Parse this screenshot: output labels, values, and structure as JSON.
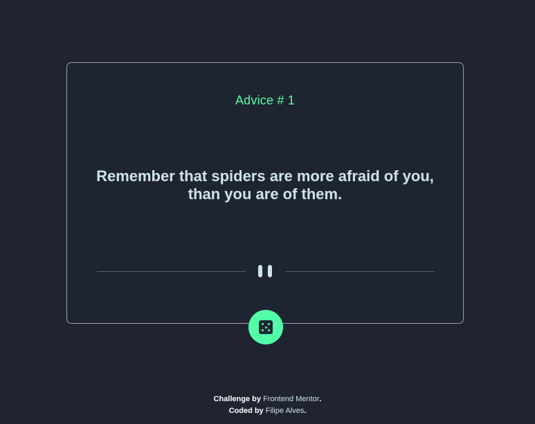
{
  "card": {
    "advice_label": "Advice # 1",
    "quote_line_1": "Remember that spiders are more afraid of you,",
    "quote_line_2": "than you are of them."
  },
  "footer": {
    "challenge_prefix": "Challenge by ",
    "challenge_link": "Frontend Mentor",
    "challenge_suffix": ".",
    "coded_prefix": "Coded by ",
    "coded_link": "Filipe Alves",
    "coded_suffix": "."
  },
  "icons": {
    "divider_icon": "pause-icon",
    "button_icon": "dice-icon"
  },
  "colors": {
    "background": "#1f2430",
    "accent": "#52ffa8",
    "text": "#cee3e9",
    "divider": "#4f5d74"
  }
}
